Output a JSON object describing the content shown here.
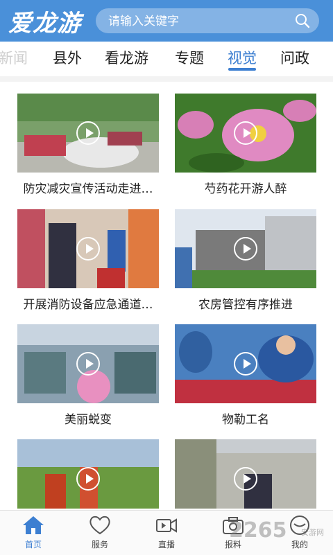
{
  "header": {
    "logo_text": "爱龙游",
    "search_placeholder": "请输入关键字",
    "brand_color": "#4a90d9"
  },
  "tabs": [
    {
      "label": "新闻",
      "state": "faded"
    },
    {
      "label": "县外",
      "state": "normal"
    },
    {
      "label": "看龙游",
      "state": "normal"
    },
    {
      "label": "专题",
      "state": "normal"
    },
    {
      "label": "视觉",
      "state": "active"
    },
    {
      "label": "问政",
      "state": "normal"
    }
  ],
  "videos": [
    {
      "title": "防灾减灾宣传活动走进…",
      "icon": "play-icon"
    },
    {
      "title": "芍药花开游人醉",
      "icon": "play-icon"
    },
    {
      "title": "开展消防设备应急通道…",
      "icon": "play-icon"
    },
    {
      "title": "农房管控有序推进",
      "icon": "play-icon"
    },
    {
      "title": "美丽蜕变",
      "icon": "play-icon"
    },
    {
      "title": "物勒工名",
      "icon": "play-icon"
    },
    {
      "title": "",
      "icon": "play-icon"
    },
    {
      "title": "",
      "icon": "play-icon"
    }
  ],
  "bottom_nav": [
    {
      "label": "首页",
      "icon": "home-icon",
      "active": true
    },
    {
      "label": "服务",
      "icon": "heart-icon",
      "active": false
    },
    {
      "label": "直播",
      "icon": "video-camera-icon",
      "active": false
    },
    {
      "label": "报料",
      "icon": "camera-icon",
      "active": false
    },
    {
      "label": "我的",
      "icon": "user-icon",
      "active": false
    }
  ],
  "watermark": {
    "main": "2265",
    "sub": "安游网"
  },
  "colors": {
    "accent": "#3d7fd1",
    "tab_inactive": "#222222"
  }
}
